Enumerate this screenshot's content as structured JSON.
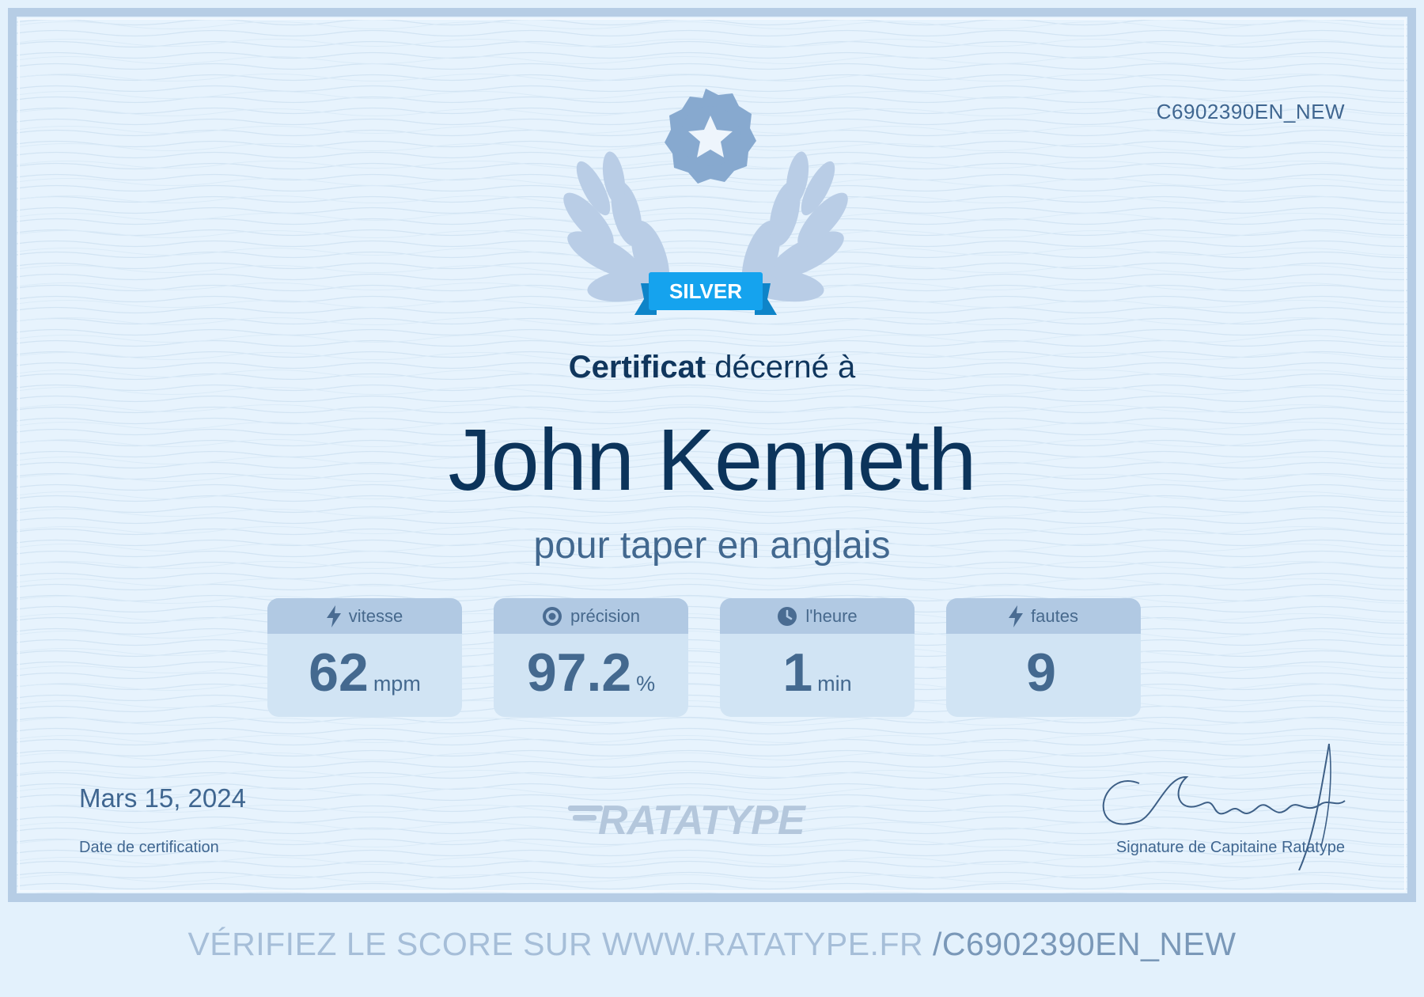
{
  "certificate": {
    "id": "C6902390EN_NEW",
    "badge_label": "SILVER",
    "awarded_strong": "Certificat",
    "awarded_rest": "décerné à",
    "recipient": "John Kenneth",
    "subtitle": "pour taper en anglais",
    "date": "Mars 15, 2024",
    "date_label": "Date de certification",
    "logo_text": "RATATYPE",
    "signature_text": "CRatatype-fé",
    "signature_label": "Signature de Capitaine Ratatype"
  },
  "stats": [
    {
      "icon": "lightning-icon",
      "label": "vitesse",
      "value": "62",
      "unit": "mpm"
    },
    {
      "icon": "target-icon",
      "label": "précision",
      "value": "97.2",
      "unit": "%"
    },
    {
      "icon": "clock-icon",
      "label": "l'heure",
      "value": "1",
      "unit": "min"
    },
    {
      "icon": "lightning-icon",
      "label": "fautes",
      "value": "9",
      "unit": ""
    }
  ],
  "verify": {
    "prefix": "VÉRIFIEZ LE SCORE SUR WWW.RATATYPE.FR",
    "path": "/C6902390EN_NEW"
  },
  "colors": {
    "primary_text": "#0c345b",
    "accent_blue": "#12a0ec",
    "stat_header": "#b1c9e3",
    "stat_body": "#d1e4f4",
    "border": "#b6cde5"
  }
}
